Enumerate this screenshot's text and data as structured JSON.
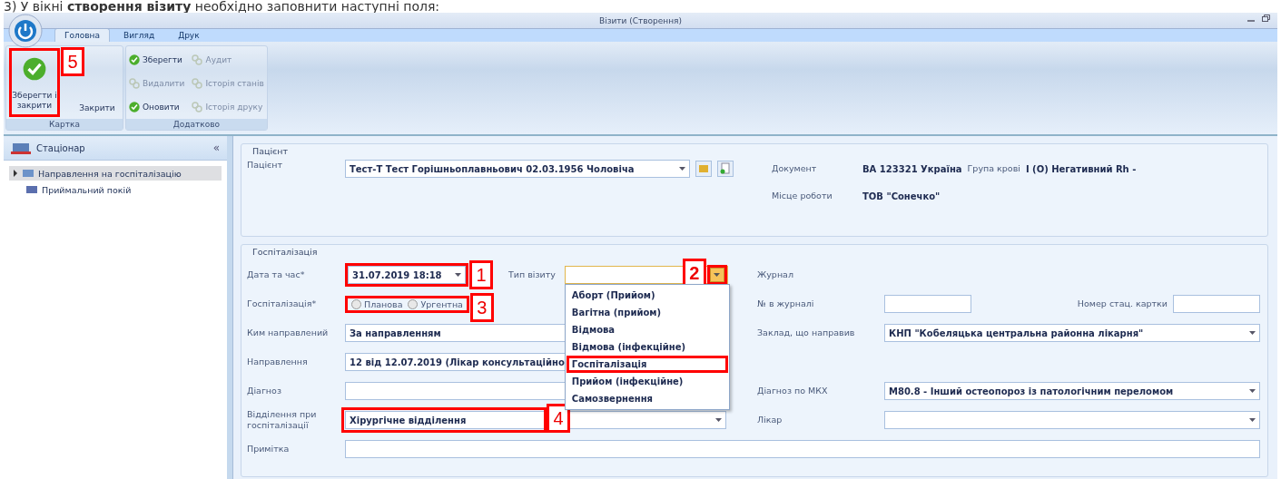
{
  "caption": "3) У вікні **створення візиту** необхідно заповнити наступні поля:",
  "window": {
    "title": "Візити (Створення)"
  },
  "tabs": [
    {
      "label": "Головна",
      "selected": true
    },
    {
      "label": "Вигляд",
      "selected": false
    },
    {
      "label": "Друк",
      "selected": false
    }
  ],
  "ribbon": {
    "large_group": {
      "label": "Картка",
      "buttons": [
        {
          "label": "Зберегти і закрити",
          "show_icon": true,
          "callout": "5"
        },
        {
          "label": "Закрити",
          "show_icon": false
        }
      ]
    },
    "small_group": {
      "label": "Додатково",
      "buttons": [
        {
          "label": "Зберегти",
          "disabled": false
        },
        {
          "label": "Аудит",
          "disabled": true
        },
        {
          "label": "Видалити",
          "disabled": true
        },
        {
          "label": "Історія станів",
          "disabled": true
        },
        {
          "label": "Оновити",
          "disabled": false
        },
        {
          "label": "Історія друку",
          "disabled": true
        }
      ]
    }
  },
  "sidebar": {
    "title": "Стаціонар",
    "collapse": "«",
    "items": [
      {
        "label": "Направлення на госпіталізацію",
        "selected": true,
        "expandable": true
      },
      {
        "label": "Приймальний покій",
        "selected": false,
        "expandable": false
      }
    ]
  },
  "patient": {
    "legend": "Пацієнт",
    "label": "Пацієнт",
    "value": "Тест-Т Тест Горішньоплавньович 02.03.1956 Чоловіча",
    "info": [
      {
        "label": "Документ",
        "value": "ВА 123321 Україна",
        "extra_label": "Група крові",
        "extra_value": "I (O) Негативний Rh -"
      },
      {
        "label": "Місце роботи",
        "value": "ТОВ \"Сонечко\""
      }
    ]
  },
  "hospitalization": {
    "legend": "Госпіталізація",
    "rows": [
      {
        "label": "Дата та час*",
        "field": {
          "kind": "combo",
          "value": "31.07.2019 18:18",
          "callout": "1"
        },
        "extra": {
          "label": "Тип візиту",
          "kind": "combo",
          "open": true,
          "callout": "2",
          "options": [
            {
              "label": "Аборт (Прийом)",
              "highlighted": false
            },
            {
              "label": "Вагітна (прийом)",
              "highlighted": false
            },
            {
              "label": "Відмова",
              "highlighted": false
            },
            {
              "label": "Відмова (інфекційне)",
              "highlighted": false
            },
            {
              "label": "Госпіталізація",
              "highlighted": true
            },
            {
              "label": "Прийом (інфекційне)",
              "highlighted": false
            },
            {
              "label": "Самозвернення",
              "highlighted": false
            }
          ]
        },
        "right": {
          "label": "Журнал"
        }
      },
      {
        "label": "Госпіталізація*",
        "field": {
          "kind": "radio",
          "callout": "3",
          "options": [
            {
              "label": "Планова",
              "selected": false
            },
            {
              "label": "Ургентна",
              "selected": false
            }
          ]
        },
        "right": {
          "label": "№ в журналі",
          "kind": "text",
          "extra_label": "Номер стац. картки"
        }
      },
      {
        "label": "Ким направлений",
        "field": {
          "kind": "text",
          "value": "За направленням"
        },
        "right": {
          "label": "Заклад, що направив",
          "kind": "combo",
          "value": "КНП \"Кобеляцька центральна районна лікарня\""
        }
      },
      {
        "label": "Направлення",
        "field": {
          "kind": "text",
          "value": "12 від 12.07.2019 (Лікар консультаційно"
        }
      },
      {
        "label": "Діагноз",
        "field": {
          "kind": "text"
        },
        "right": {
          "label": "Діагноз по МКХ",
          "kind": "combo",
          "value": "M80.8 - Інший остеопороз із патологічним переломом"
        }
      },
      {
        "label": "Відділення при госпіталізації",
        "field": {
          "kind": "combo",
          "value": "Хірургічне відділення",
          "callout": "4"
        },
        "right": {
          "label": "Лікар",
          "kind": "combo"
        }
      },
      {
        "label": "Примітка",
        "field": {
          "kind": "text",
          "wide": true
        }
      }
    ]
  }
}
